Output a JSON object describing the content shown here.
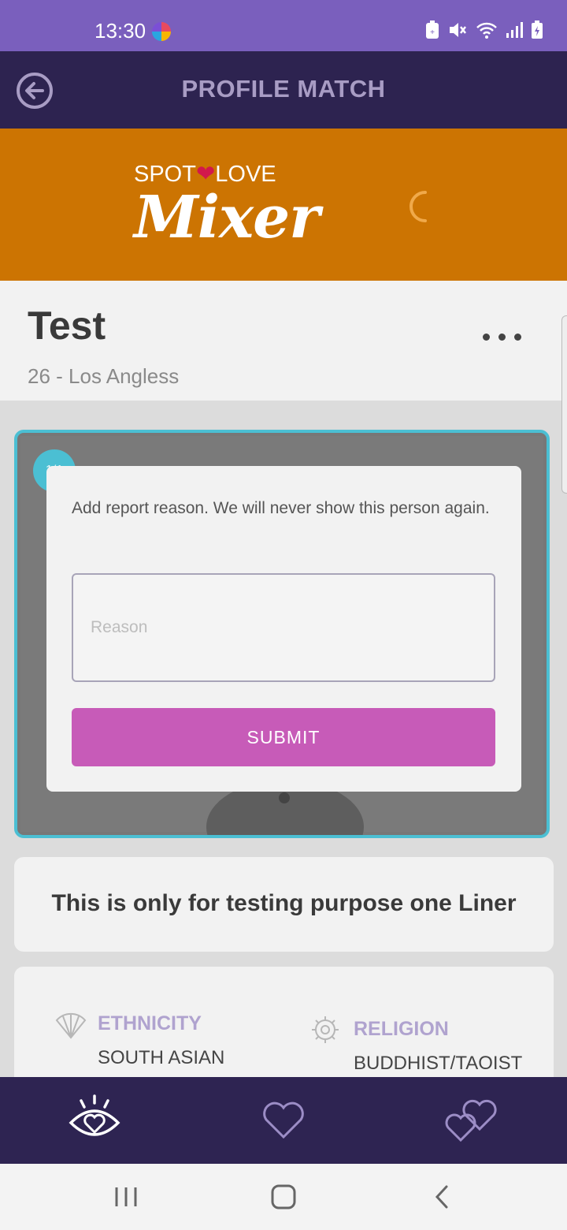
{
  "status_bar": {
    "time": "13:30",
    "icons": [
      "edge-browser-icon",
      "battery-saver-icon",
      "mute-icon",
      "wifi-icon",
      "signal-icon",
      "battery-charging-icon"
    ]
  },
  "app_bar": {
    "title": "PROFILE MATCH",
    "back_icon": "back-arrow-circle-icon"
  },
  "banner": {
    "brand_top_left": "SPOT",
    "brand_top_right": "LOVE",
    "brand_main": "Mixer",
    "bg_color": "#cc7402"
  },
  "profile": {
    "name": "Test",
    "subtitle": "26 - Los Angless",
    "more_icon": "more-horizontal-icon"
  },
  "photo": {
    "counter": "1/1",
    "frame_color": "#4bbfd3"
  },
  "report_dialog": {
    "message": "Add report reason. We will never show this person again.",
    "reason_placeholder": "Reason",
    "reason_value": "",
    "submit_label": "SUBMIT",
    "submit_color": "#c75bb8"
  },
  "about": {
    "text": "This is only for testing purpose one Liner"
  },
  "details": [
    {
      "label": "ETHNICITY",
      "value": "SOUTH ASIAN",
      "icon": "hand-fan-icon"
    },
    {
      "label": "RELIGION",
      "value": "BUDDHIST/TAOIST",
      "icon": "dharma-wheel-icon"
    }
  ],
  "bottom_nav": {
    "items": [
      "eye-heart-icon",
      "heart-icon",
      "two-hearts-icon"
    ],
    "bg_color": "#2e2452"
  },
  "system_nav": [
    "recent-apps-icon",
    "home-icon",
    "back-icon"
  ]
}
